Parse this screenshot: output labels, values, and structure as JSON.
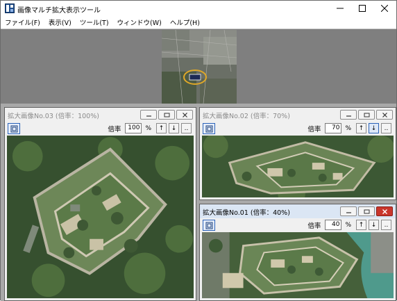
{
  "app": {
    "title": "画像マルチ拡大表示ツール",
    "icon": "app-logo-icon"
  },
  "window_controls": {
    "minimize": "minimize-icon",
    "maximize": "maximize-icon",
    "close": "close-icon"
  },
  "menu": [
    {
      "label": "ファイル(F)"
    },
    {
      "label": "表示(V)"
    },
    {
      "label": "ツール(T)"
    },
    {
      "label": "ウィンドウ(W)"
    },
    {
      "label": "ヘルプ(H)"
    }
  ],
  "windows": [
    {
      "title": "拡大画像No.03 (倍率：100%)",
      "rate_label": "倍率",
      "rate_value": "100",
      "unit": "%",
      "active": false,
      "down_pressed": false
    },
    {
      "title": "拡大画像No.02 (倍率：70%)",
      "rate_label": "倍率",
      "rate_value": "70",
      "unit": "%",
      "active": false,
      "down_pressed": true
    },
    {
      "title": "拡大画像No.01 (倍率：40%)",
      "rate_label": "倍率",
      "rate_value": "40",
      "unit": "%",
      "active": true,
      "down_pressed": false
    }
  ],
  "toolbar_buttons": {
    "up": "↑",
    "down": "↓",
    "more": ".."
  },
  "colors": {
    "accent": "#2a62b8",
    "close_active": "#c9362c",
    "workspace": "#a9a9a9",
    "overview_bg": "#7f7f7f",
    "active_title": "#dbe6f4"
  }
}
